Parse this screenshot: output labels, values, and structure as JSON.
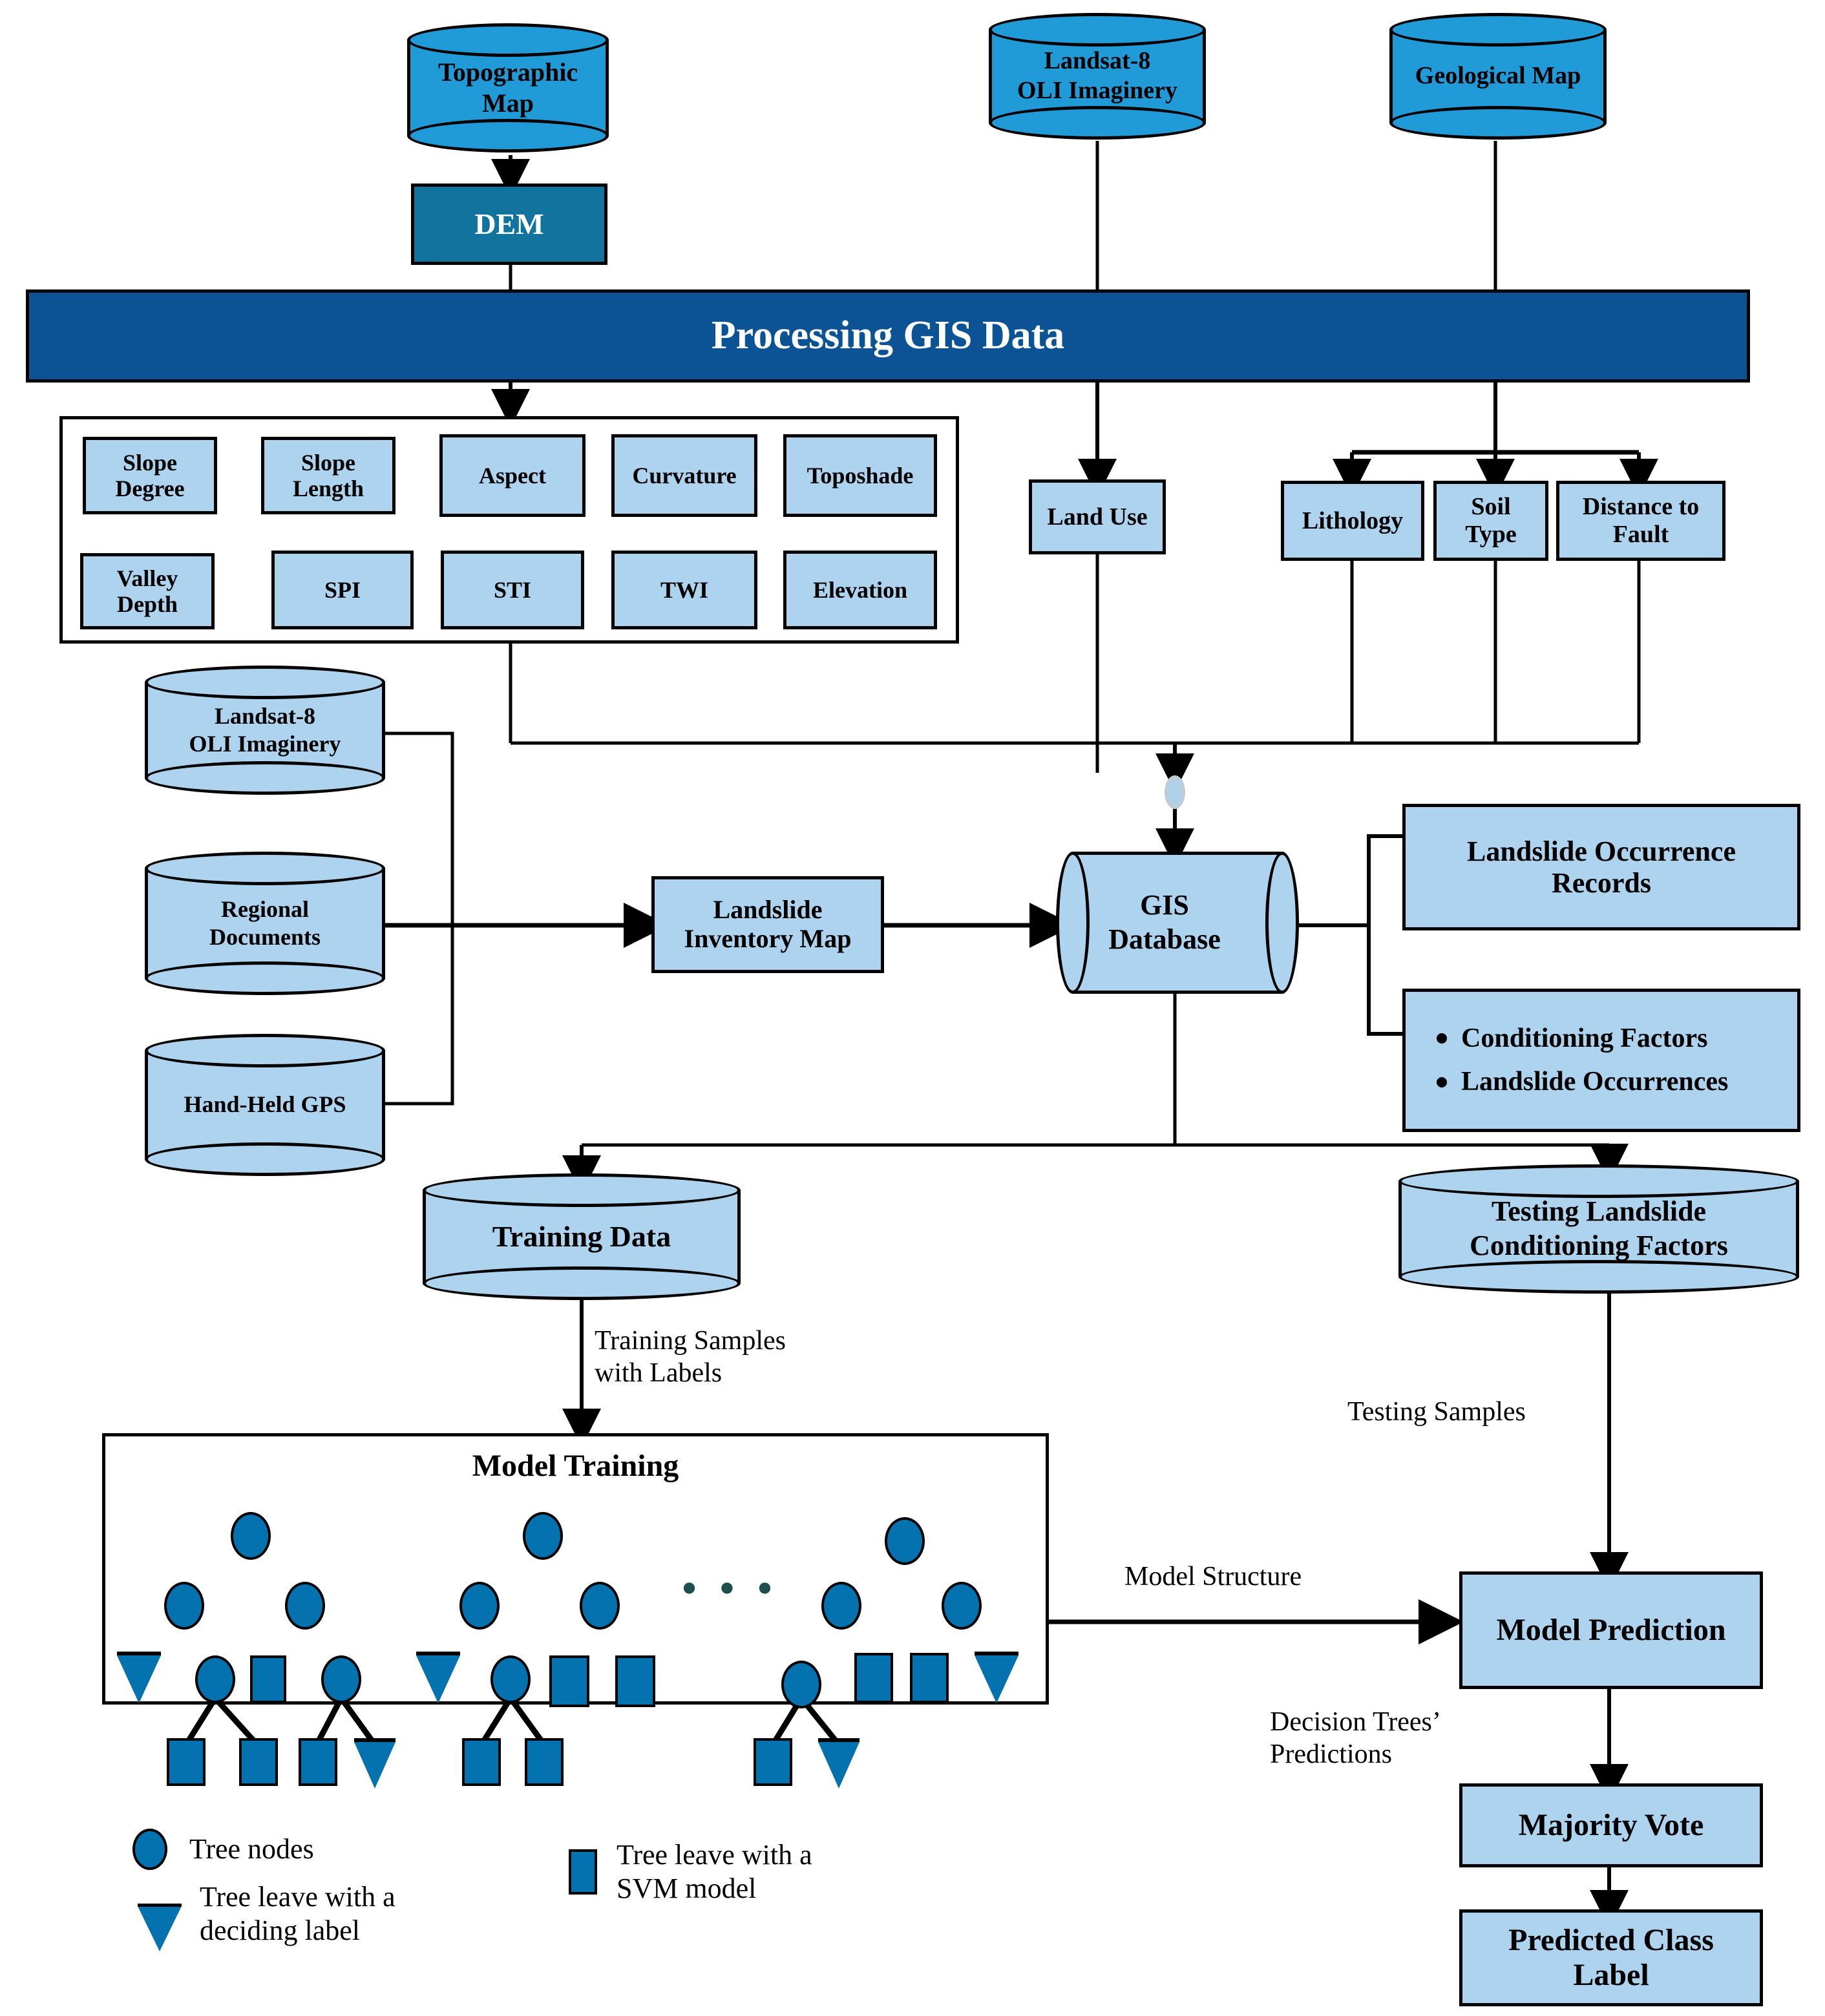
{
  "sources": {
    "topographic_map": "Topographic\nMap",
    "landsat_top": "Landsat-8\nOLI Imaginery",
    "geological_map": "Geological Map"
  },
  "dem": {
    "label": "DEM"
  },
  "band": {
    "title": "Processing GIS Data"
  },
  "factors": {
    "row1": [
      "Slope\nDegree",
      "Slope\nLength",
      "Aspect",
      "Curvature",
      "Toposhade"
    ],
    "row2": [
      "Valley\nDepth",
      "SPI",
      "STI",
      "TWI",
      "Elevation"
    ]
  },
  "right_factors": {
    "land_use": "Land Use",
    "lithology": "Lithology",
    "soil_type": "Soil\nType",
    "distance_to_fault": "Distance to\nFault"
  },
  "inventory_sources": {
    "landsat": "Landsat-8\nOLI Imaginery",
    "regional_documents": "Regional\nDocuments",
    "hand_held_gps": "Hand-Held GPS"
  },
  "inventory_map": {
    "label": "Landslide\nInventory Map"
  },
  "gis_database": {
    "label": "GIS\nDatabase"
  },
  "db_outputs": {
    "occurrence_records": "Landslide Occurrence\nRecords",
    "bullets": [
      "Conditioning Factors",
      "Landslide Occurrences"
    ]
  },
  "datasets": {
    "training_data": "Training Data",
    "testing_factors": "Testing Landslide\nConditioning Factors"
  },
  "edge_labels": {
    "training_samples": "Training Samples\nwith Labels",
    "testing_samples": "Testing Samples",
    "model_structure": "Model Structure",
    "tree_predictions": "Decision Trees’\nPredictions"
  },
  "model_training": {
    "title": "Model Training",
    "ellipsis": "• • •"
  },
  "legend": {
    "tree_nodes": "Tree nodes",
    "deciding_label": "Tree leave with a\ndeciding label",
    "svm_model": "Tree leave with a\nSVM model"
  },
  "prediction_chain": {
    "model_prediction": "Model Prediction",
    "majority_vote": "Majority Vote",
    "predicted_class_label": "Predicted Class\nLabel"
  },
  "colors": {
    "light_blue": "#ADD3EE",
    "bright_blue": "#219AD8",
    "dem_blue": "#12749E",
    "band_blue": "#0B5394",
    "node_blue": "#0572B0",
    "outline": "#000000"
  }
}
